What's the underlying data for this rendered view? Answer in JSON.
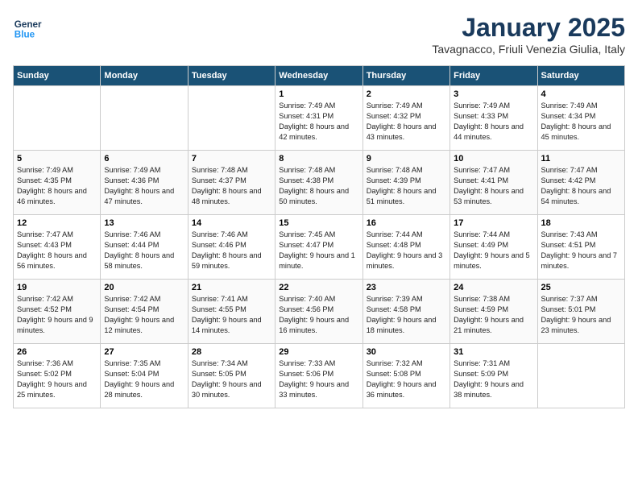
{
  "header": {
    "logo_line1": "General",
    "logo_line2": "Blue",
    "month_title": "January 2025",
    "subtitle": "Tavagnacco, Friuli Venezia Giulia, Italy"
  },
  "days_of_week": [
    "Sunday",
    "Monday",
    "Tuesday",
    "Wednesday",
    "Thursday",
    "Friday",
    "Saturday"
  ],
  "weeks": [
    [
      {
        "day": "",
        "info": ""
      },
      {
        "day": "",
        "info": ""
      },
      {
        "day": "",
        "info": ""
      },
      {
        "day": "1",
        "info": "Sunrise: 7:49 AM\nSunset: 4:31 PM\nDaylight: 8 hours and 42 minutes."
      },
      {
        "day": "2",
        "info": "Sunrise: 7:49 AM\nSunset: 4:32 PM\nDaylight: 8 hours and 43 minutes."
      },
      {
        "day": "3",
        "info": "Sunrise: 7:49 AM\nSunset: 4:33 PM\nDaylight: 8 hours and 44 minutes."
      },
      {
        "day": "4",
        "info": "Sunrise: 7:49 AM\nSunset: 4:34 PM\nDaylight: 8 hours and 45 minutes."
      }
    ],
    [
      {
        "day": "5",
        "info": "Sunrise: 7:49 AM\nSunset: 4:35 PM\nDaylight: 8 hours and 46 minutes."
      },
      {
        "day": "6",
        "info": "Sunrise: 7:49 AM\nSunset: 4:36 PM\nDaylight: 8 hours and 47 minutes."
      },
      {
        "day": "7",
        "info": "Sunrise: 7:48 AM\nSunset: 4:37 PM\nDaylight: 8 hours and 48 minutes."
      },
      {
        "day": "8",
        "info": "Sunrise: 7:48 AM\nSunset: 4:38 PM\nDaylight: 8 hours and 50 minutes."
      },
      {
        "day": "9",
        "info": "Sunrise: 7:48 AM\nSunset: 4:39 PM\nDaylight: 8 hours and 51 minutes."
      },
      {
        "day": "10",
        "info": "Sunrise: 7:47 AM\nSunset: 4:41 PM\nDaylight: 8 hours and 53 minutes."
      },
      {
        "day": "11",
        "info": "Sunrise: 7:47 AM\nSunset: 4:42 PM\nDaylight: 8 hours and 54 minutes."
      }
    ],
    [
      {
        "day": "12",
        "info": "Sunrise: 7:47 AM\nSunset: 4:43 PM\nDaylight: 8 hours and 56 minutes."
      },
      {
        "day": "13",
        "info": "Sunrise: 7:46 AM\nSunset: 4:44 PM\nDaylight: 8 hours and 58 minutes."
      },
      {
        "day": "14",
        "info": "Sunrise: 7:46 AM\nSunset: 4:46 PM\nDaylight: 8 hours and 59 minutes."
      },
      {
        "day": "15",
        "info": "Sunrise: 7:45 AM\nSunset: 4:47 PM\nDaylight: 9 hours and 1 minute."
      },
      {
        "day": "16",
        "info": "Sunrise: 7:44 AM\nSunset: 4:48 PM\nDaylight: 9 hours and 3 minutes."
      },
      {
        "day": "17",
        "info": "Sunrise: 7:44 AM\nSunset: 4:49 PM\nDaylight: 9 hours and 5 minutes."
      },
      {
        "day": "18",
        "info": "Sunrise: 7:43 AM\nSunset: 4:51 PM\nDaylight: 9 hours and 7 minutes."
      }
    ],
    [
      {
        "day": "19",
        "info": "Sunrise: 7:42 AM\nSunset: 4:52 PM\nDaylight: 9 hours and 9 minutes."
      },
      {
        "day": "20",
        "info": "Sunrise: 7:42 AM\nSunset: 4:54 PM\nDaylight: 9 hours and 12 minutes."
      },
      {
        "day": "21",
        "info": "Sunrise: 7:41 AM\nSunset: 4:55 PM\nDaylight: 9 hours and 14 minutes."
      },
      {
        "day": "22",
        "info": "Sunrise: 7:40 AM\nSunset: 4:56 PM\nDaylight: 9 hours and 16 minutes."
      },
      {
        "day": "23",
        "info": "Sunrise: 7:39 AM\nSunset: 4:58 PM\nDaylight: 9 hours and 18 minutes."
      },
      {
        "day": "24",
        "info": "Sunrise: 7:38 AM\nSunset: 4:59 PM\nDaylight: 9 hours and 21 minutes."
      },
      {
        "day": "25",
        "info": "Sunrise: 7:37 AM\nSunset: 5:01 PM\nDaylight: 9 hours and 23 minutes."
      }
    ],
    [
      {
        "day": "26",
        "info": "Sunrise: 7:36 AM\nSunset: 5:02 PM\nDaylight: 9 hours and 25 minutes."
      },
      {
        "day": "27",
        "info": "Sunrise: 7:35 AM\nSunset: 5:04 PM\nDaylight: 9 hours and 28 minutes."
      },
      {
        "day": "28",
        "info": "Sunrise: 7:34 AM\nSunset: 5:05 PM\nDaylight: 9 hours and 30 minutes."
      },
      {
        "day": "29",
        "info": "Sunrise: 7:33 AM\nSunset: 5:06 PM\nDaylight: 9 hours and 33 minutes."
      },
      {
        "day": "30",
        "info": "Sunrise: 7:32 AM\nSunset: 5:08 PM\nDaylight: 9 hours and 36 minutes."
      },
      {
        "day": "31",
        "info": "Sunrise: 7:31 AM\nSunset: 5:09 PM\nDaylight: 9 hours and 38 minutes."
      },
      {
        "day": "",
        "info": ""
      }
    ]
  ]
}
